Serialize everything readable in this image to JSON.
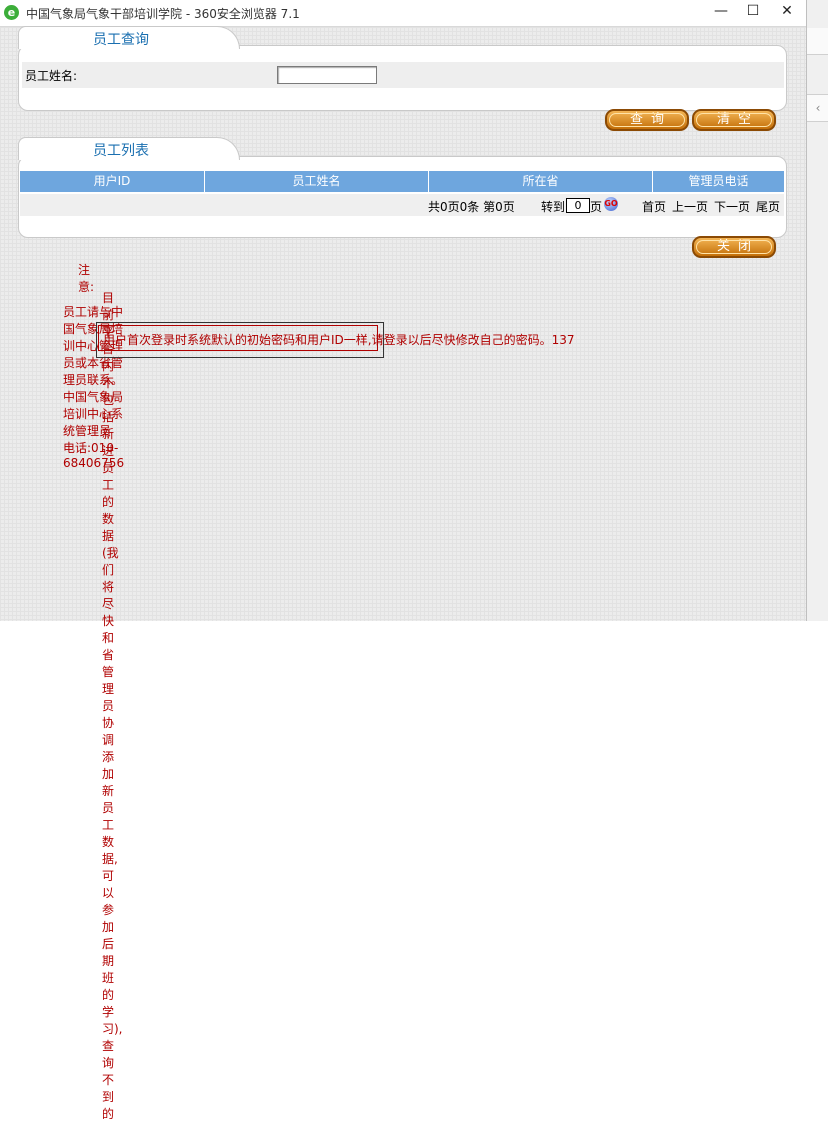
{
  "browser": {
    "title": "中国气象局气象干部培训学院 - 360安全浏览器 7.1",
    "icon_name": "ie-icon",
    "minimize_label": "—",
    "maximize_label": "☐",
    "close_label": "✕"
  },
  "query_panel": {
    "tab_title": "员工查询",
    "name_label": "员工姓名:",
    "name_value": "",
    "query_button": "查询",
    "clear_button": "清空"
  },
  "list_panel": {
    "tab_title": "员工列表",
    "columns": [
      "用户ID",
      "员工姓名",
      "所在省",
      "管理员电话"
    ],
    "pager": {
      "summary": "共0页0条 第0页",
      "goto_label": "转到",
      "goto_value": "0",
      "page_unit": "页",
      "go_label": "GO",
      "first": "首页",
      "prev": "上一页",
      "next": "下一页",
      "last": "尾页"
    },
    "close_button": "关闭"
  },
  "notice": {
    "title": "注意:",
    "line1": "目前平台内不包括新进员工的数据(我们将尽快和省管理员协调添加新员工数据,可以参加后期班的学习),查询不到的",
    "line2": "员工请与中国气象局培训中心管理员或本省管理员联系。中国气象局培训中心系统管理员 电话:010-68406756",
    "line3": "用户首次登录时系统默认的初始密码和用户ID一样,请登录以后尽快修改自己的密码。137"
  },
  "colors": {
    "header_blue": "#6ea6de",
    "tab_text_blue": "#1a6fb0",
    "button_orange": "#d88a1e",
    "notice_red": "#b00000"
  }
}
